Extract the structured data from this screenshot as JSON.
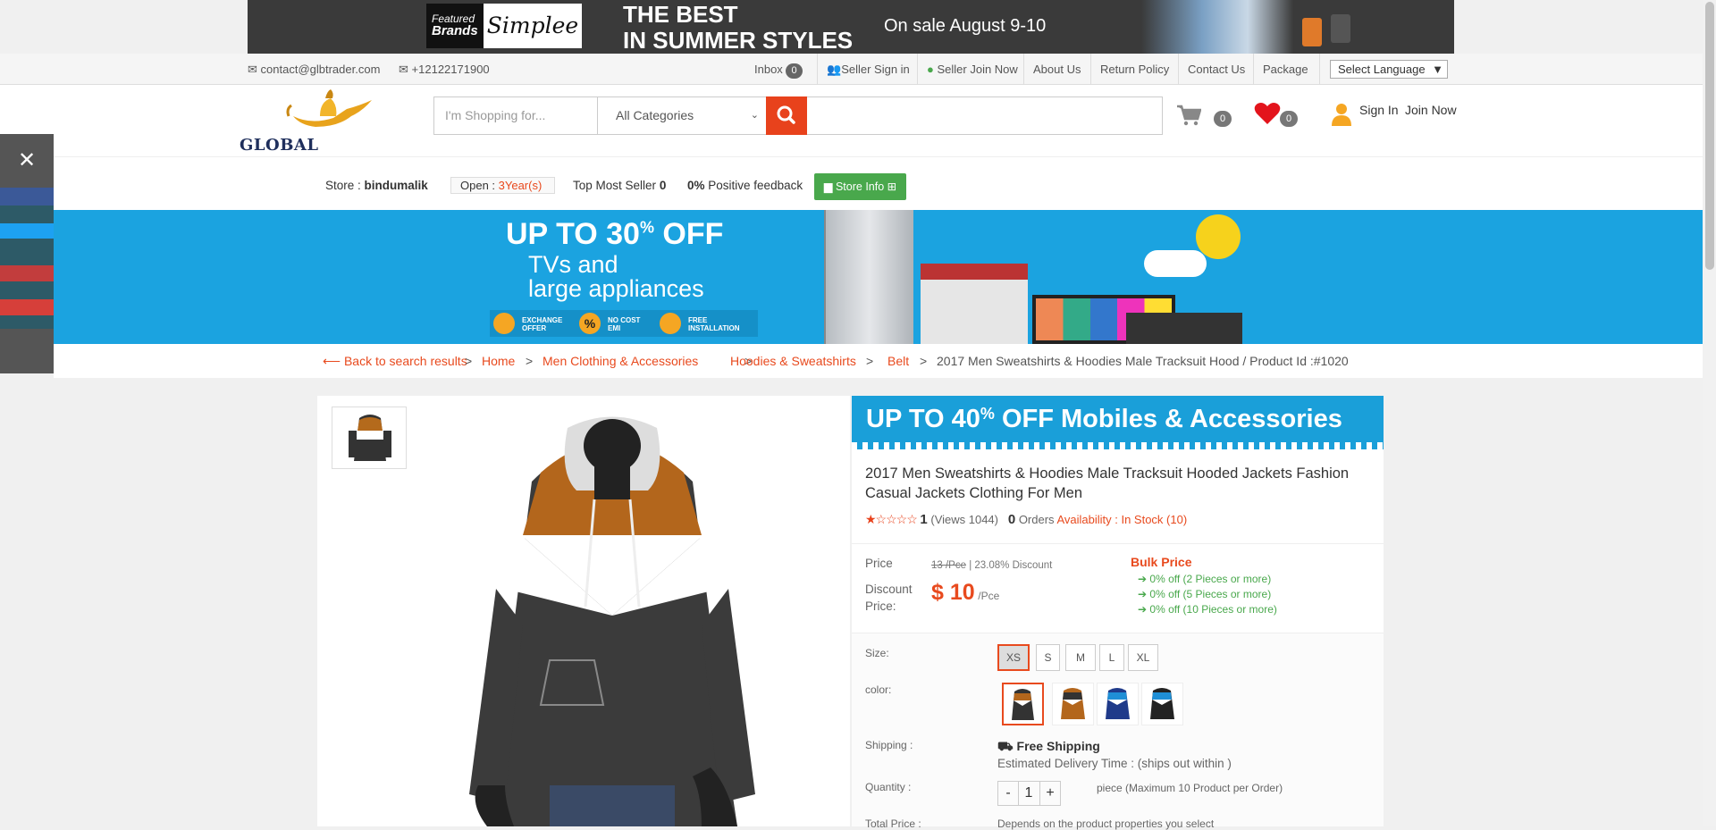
{
  "top_banner": {
    "featured_small": "Featured",
    "featured_big": "Brands",
    "brand": "Simplee",
    "headline_line1": "THE BEST",
    "headline_line2": "IN SUMMER STYLES",
    "sale": "On sale August 9-10"
  },
  "util_bar": {
    "email": "contact@glbtrader.com",
    "phone": "+12122171900",
    "inbox_label": "Inbox",
    "inbox_count": "0",
    "seller_sign_in": "Seller Sign in",
    "seller_join": "Seller Join Now",
    "about": "About Us",
    "return_policy": "Return Policy",
    "contact": "Contact Us",
    "package": "Package",
    "language": "Select Language"
  },
  "header": {
    "logo_text": "GLOBAL TRADER",
    "search_placeholder": "I'm Shopping for...",
    "category": "All Categories",
    "cart_count": "0",
    "wishlist_count": "0",
    "sign_in": "Sign In",
    "join_now": "Join Now"
  },
  "store": {
    "store_label": "Store : ",
    "store_name": "bindumalik",
    "open_label": "Open : ",
    "open_value": "3Year(s)",
    "top_seller_label": "Top Most Seller",
    "top_seller_value": "0",
    "feedback_value": "0%",
    "feedback_label": "Positive feedback",
    "store_info": "Store Info"
  },
  "promo": {
    "line1": "UP TO 30",
    "line1_sup": "%",
    "line1_end": " OFF",
    "line2": "TVs and",
    "line3": "large appliances",
    "feat1": "EXCHANGE OFFER",
    "feat2": "NO COST EMI",
    "feat3": "FREE INSTALLATION"
  },
  "breadcrumb": {
    "back": "Back to search results",
    "home": "Home",
    "cat1": "Men Clothing & Accessories",
    "cat2": "Hoodies & Sweatshirts",
    "cat3": "Belt",
    "current": "2017 Men Sweatshirts & Hoodies Male Tracksuit Hood",
    "product_id": "/ Product Id :#1020",
    "sep": ">"
  },
  "product": {
    "banner_a": "UP TO 40",
    "banner_sup": "%",
    "banner_b": " OFF  Mobiles & Accessories",
    "title": "2017 Men Sweatshirts & Hoodies Male Tracksuit Hooded Jackets Fashion Casual Jackets Clothing For Men",
    "rating_count": "1",
    "views": "(Views 1044)",
    "orders_count": "0",
    "orders_label": "Orders",
    "availability": "Availability : In Stock (10)",
    "price_label": "Price",
    "original_price": "13 /Pce",
    "discount": "| 23.08% Discount",
    "discount_label": "Discount Price:",
    "discount_price": "$ 10",
    "per_unit": "/Pce",
    "bulk_title": "Bulk Price",
    "bulk": [
      "0% off (2 Pieces or more)",
      "0% off (5 Pieces or more)",
      "0% off (10 Pieces or more)"
    ],
    "size_label": "Size:",
    "sizes": [
      "XS",
      "S",
      "M",
      "L",
      "XL"
    ],
    "color_label": "color:",
    "shipping_label": "Shipping :",
    "shipping_value": "Free Shipping",
    "delivery": "Estimated Delivery Time : (ships out within )",
    "quantity_label": "Quantity :",
    "qty_minus": "-",
    "qty_value": "1",
    "qty_plus": "+",
    "qty_note": "piece (Maximum 10 Product per Order)",
    "total_label": "Total Price :",
    "total_note": "Depends on the product properties you select"
  },
  "colors": {
    "accent": "#e84a1e",
    "promo_blue": "#1ba3e0",
    "green": "#49a84c"
  }
}
